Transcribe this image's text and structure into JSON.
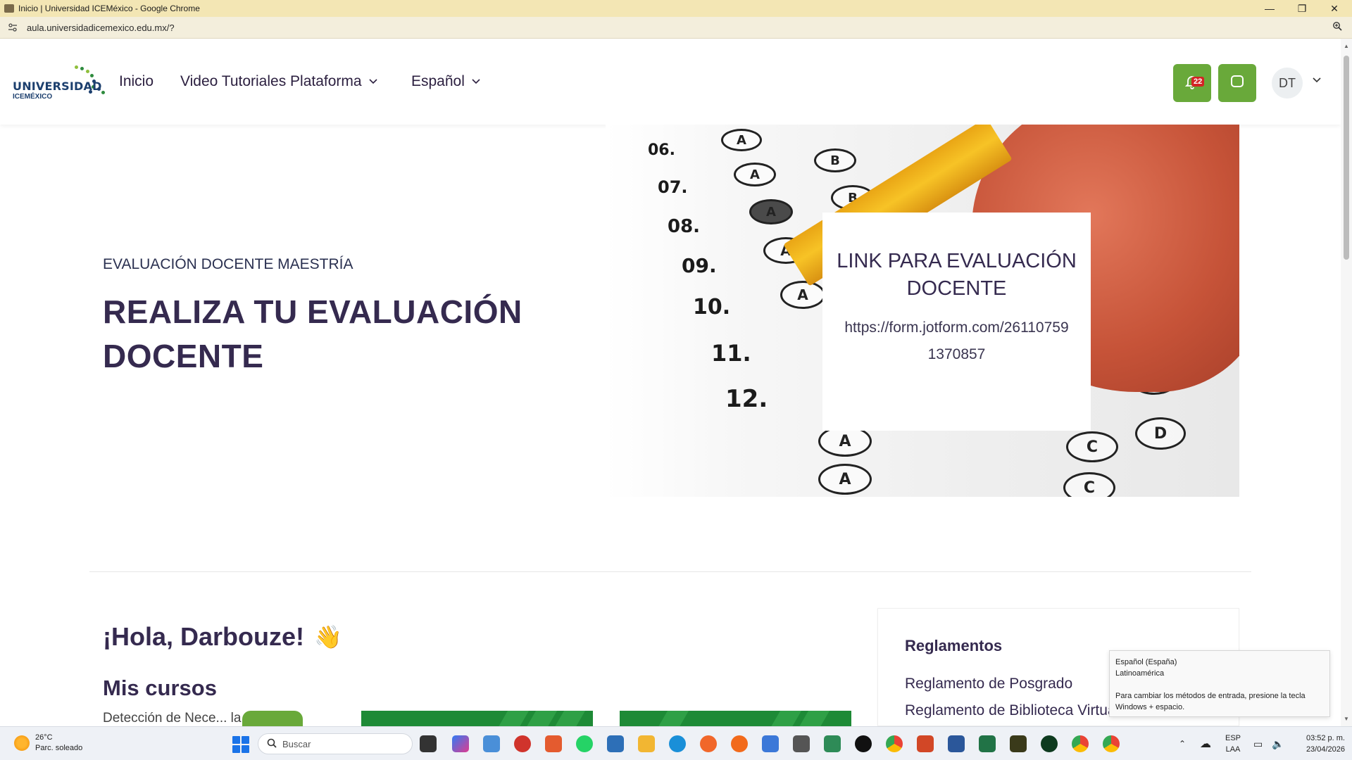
{
  "window": {
    "title": "Inicio | Universidad ICEMéxico - Google Chrome",
    "minimize": "—",
    "restore": "❐",
    "close": "✕"
  },
  "address": {
    "url": "aula.universidadicemexico.edu.mx/?"
  },
  "logo": {
    "line1": "UNIVERSIDAD",
    "line2": "ICEMÉXICO"
  },
  "nav": {
    "items": [
      {
        "label": "Inicio"
      },
      {
        "label": "Video Tutoriales Plataforma"
      },
      {
        "label": "Español"
      }
    ]
  },
  "header": {
    "notifications_count": "22",
    "avatar_initials": "DT",
    "accent_color": "#69a93a"
  },
  "hero": {
    "kicker": "EVALUACIÓN DOCENTE MAESTRÍA",
    "title": "REALIZA TU EVALUACIÓN DOCENTE",
    "image_numbers": [
      "06.",
      "07.",
      "08.",
      "09.",
      "10.",
      "11.",
      "12."
    ],
    "image_bubbles": [
      "A",
      "B",
      "A",
      "B",
      "A",
      "A",
      "A",
      "D",
      "D",
      "D",
      "D",
      "A",
      "A",
      "C",
      "C"
    ],
    "card": {
      "title": "LINK PARA EVALUACIÓN DOCENTE",
      "url": "https://form.jotform.com/261107591370857"
    }
  },
  "dashboard": {
    "greeting": "¡Hola, Darbouze!",
    "wave": "👋",
    "my_courses": "Mis cursos",
    "broken_course_alt": "Detección de Nece...  la"
  },
  "reglamentos": {
    "title": "Reglamentos",
    "items": [
      "Reglamento de Posgrado",
      "Reglamento de Biblioteca Virtual"
    ]
  },
  "ime_tooltip": {
    "line1": "Español (España)",
    "line2": "Latinoamérica",
    "line3": "Para cambiar los métodos de entrada, presione la tecla Windows + espacio."
  },
  "taskbar": {
    "weather_temp": "26°C",
    "weather_desc": "Parc. soleado",
    "search_placeholder": "Buscar",
    "lang_top": "ESP",
    "lang_bottom": "LAA",
    "time": "03:52 p. m.",
    "date": "23/04/2026"
  }
}
